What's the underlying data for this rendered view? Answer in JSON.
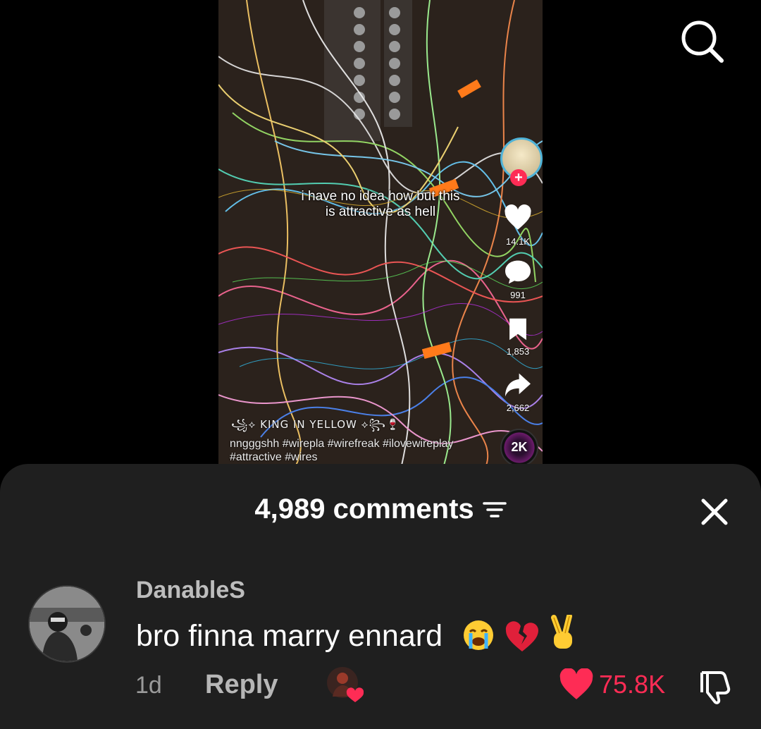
{
  "video": {
    "caption_line1": "i have no idea how but this",
    "caption_line2": "is attractive as hell",
    "author": "꧁⟡ KING IN YELLOW ⟡꧂🍷",
    "description": "nngggshh #wirepla #wirefreak #ilovewireplay #attractive #wires",
    "likes": "14.1K",
    "comments": "991",
    "saves": "1,853",
    "shares": "2,662",
    "music_disc_label": "2K"
  },
  "comments_sheet": {
    "title": "4,989 comments",
    "comment": {
      "username": "DanableS",
      "text": "bro finna marry ennard",
      "emojis": [
        "😭",
        "💔",
        "✌️"
      ],
      "time": "1d",
      "reply_label": "Reply",
      "likes": "75.8K"
    }
  },
  "colors": {
    "accent_red": "#fe2c55",
    "sheet_bg": "#1f1f1f",
    "ring_blue": "#4fb3d8"
  },
  "icons": [
    "search-icon",
    "heart-icon",
    "comment-icon",
    "bookmark-icon",
    "share-icon",
    "filter-icon",
    "close-icon",
    "dislike-icon"
  ]
}
